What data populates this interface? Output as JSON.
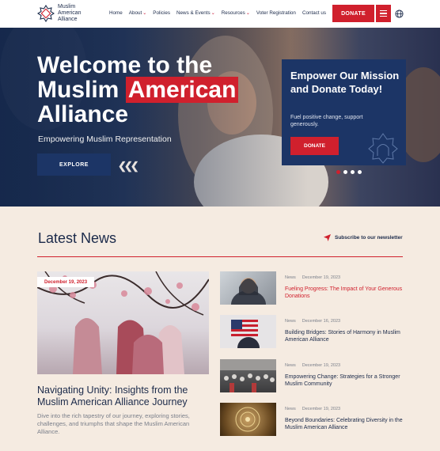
{
  "header": {
    "logo_text": "Muslim American Alliance",
    "nav": [
      {
        "label": "Home",
        "dropdown": false
      },
      {
        "label": "About",
        "dropdown": true
      },
      {
        "label": "Policies",
        "dropdown": false
      },
      {
        "label": "News & Events",
        "dropdown": true
      },
      {
        "label": "Resources",
        "dropdown": true
      },
      {
        "label": "Voter Registration",
        "dropdown": false
      },
      {
        "label": "Contact us",
        "dropdown": false
      }
    ],
    "donate_label": "DONATE",
    "icons": {
      "menu": "hamburger-menu-icon",
      "globe": "globe-icon"
    }
  },
  "hero": {
    "title_line1": "Welcome to the",
    "title_line2_plain": "Muslim ",
    "title_line2_highlight": "American",
    "title_line3": "Alliance",
    "subtitle": "Empowering Muslim Representation",
    "explore_label": "EXPLORE",
    "arrows": "❮❮❮",
    "card": {
      "title": "Empower Our Mission and  Donate Today!",
      "text": "Fuel positive change, support generously.",
      "button_label": "DONATE"
    },
    "slides": 4,
    "active_slide": 1
  },
  "news": {
    "title": "Latest News",
    "subscribe_label": "Subscribe to our newsletter",
    "featured": {
      "date": "December 19, 2023",
      "title": "Navigating Unity: Insights from the Muslim American Alliance Journey",
      "excerpt": "Dive into the rich tapestry of our journey, exploring stories, challenges, and triumphs that shape the Muslim American Alliance."
    },
    "items": [
      {
        "category": "News",
        "date": "December 19, 2023",
        "title": "Fueling Progress: The Impact of Your Generous Donations",
        "highlight": true
      },
      {
        "category": "News",
        "date": "December 16, 2023",
        "title": "Building Bridges: Stories of Harmony in Muslim American Alliance",
        "highlight": false
      },
      {
        "category": "News",
        "date": "December 19, 2023",
        "title": "Empowering Change: Strategies for a Stronger Muslim Community",
        "highlight": false
      },
      {
        "category": "News",
        "date": "December 19, 2023",
        "title": "Beyond Boundaries: Celebrating Diversity in the Muslim American Alliance",
        "highlight": false
      }
    ]
  },
  "colors": {
    "brand_red": "#d0202d",
    "brand_navy": "#1c3566",
    "page_bg": "#f5ebe1"
  }
}
